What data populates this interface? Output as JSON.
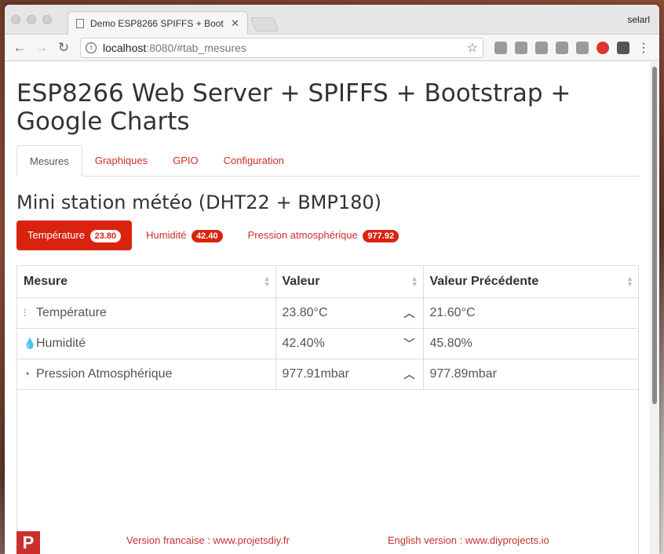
{
  "browser": {
    "tab_title": "Demo ESP8266 SPIFFS + Boot",
    "profile": "selarl",
    "url_host": "localhost",
    "url_rest": ":8080/#tab_mesures"
  },
  "page": {
    "title": "ESP8266 Web Server + SPIFFS + Bootstrap + Google Charts",
    "tabs": [
      "Mesures",
      "Graphiques",
      "GPIO",
      "Configuration"
    ],
    "section_title": "Mini station météo (DHT22 + BMP180)",
    "pills": [
      {
        "label": "Température",
        "badge": "23.80"
      },
      {
        "label": "Humidité",
        "badge": "42.40"
      },
      {
        "label": "Pression atmosphérique",
        "badge": "977.92"
      }
    ],
    "table": {
      "headers": [
        "Mesure",
        "Valeur",
        "Valeur Précédente"
      ],
      "rows": [
        {
          "icon": "thermometer-icon",
          "name": "Température",
          "value": "23.80°C",
          "trend": "up",
          "previous": "21.60°C"
        },
        {
          "icon": "droplet-icon",
          "name": "Humidité",
          "value": "42.40%",
          "trend": "down",
          "previous": "45.80%"
        },
        {
          "icon": "gauge-icon",
          "name": "Pression Atmosphérique",
          "value": "977.91mbar",
          "trend": "up",
          "previous": "977.89mbar"
        }
      ]
    },
    "footer": {
      "french_link": "Version francaise : www.projetsdiy.fr",
      "english_link": "English version : www.diyprojects.io",
      "logo_letter": "P"
    }
  },
  "colors": {
    "accent": "#d9230f",
    "link": "#c9302c"
  }
}
